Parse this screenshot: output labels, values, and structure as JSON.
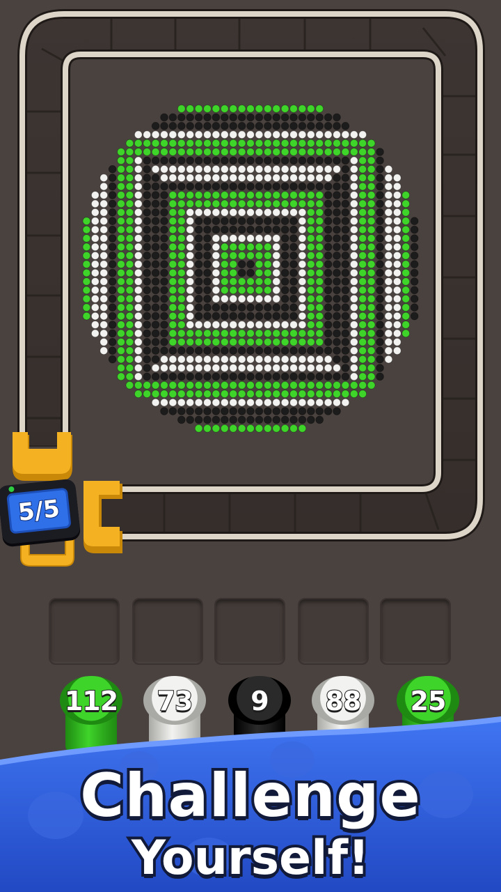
{
  "counter": {
    "label": "5/5",
    "current": 5,
    "total": 5
  },
  "palette": {
    "background": "#4a423f",
    "track_rail": "#ddd6c8",
    "track_bed": "#3a3330",
    "clamp": "#f4b223",
    "green": "#3fd42a",
    "white": "#f2f2f0",
    "black": "#1c1c1c",
    "banner_blue": "#2b5fe0"
  },
  "board": {
    "pattern": "concentric-squares-in-circle",
    "colors": [
      "green",
      "white",
      "black"
    ]
  },
  "slots": {
    "count": 5,
    "filled": 0
  },
  "spools": [
    {
      "color": "green",
      "count": "112"
    },
    {
      "color": "white",
      "count": "73"
    },
    {
      "color": "black",
      "count": "9"
    },
    {
      "color": "white",
      "count": "88"
    },
    {
      "color": "green",
      "count": "25"
    }
  ],
  "banner": {
    "line1": "Challenge",
    "line2": "Yourself!"
  }
}
